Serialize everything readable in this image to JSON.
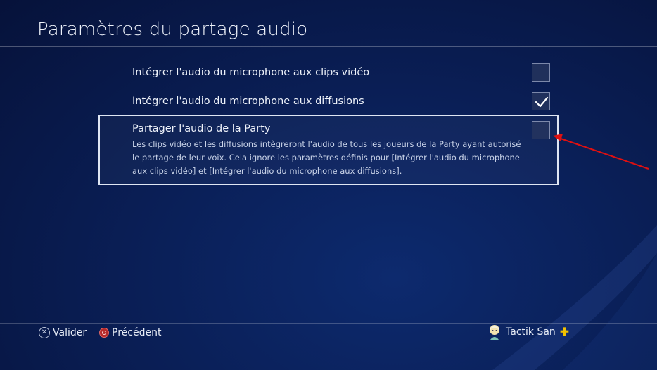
{
  "page": {
    "title": "Paramètres du partage audio"
  },
  "settings": [
    {
      "label": "Intégrer l'audio du microphone aux clips vidéo",
      "checked": false
    },
    {
      "label": "Intégrer l'audio du microphone aux diffusions",
      "checked": true
    },
    {
      "label": "Partager l'audio de la Party",
      "checked": false,
      "selected": true,
      "description": "Les clips vidéo et les diffusions intègreront l'audio de tous les joueurs de la Party ayant autorisé le partage de leur voix. Cela ignore les paramètres définis pour [Intégrer l'audio du microphone aux clips vidéo] et [Intégrer l'audio du microphone aux diffusions]."
    }
  ],
  "footer": {
    "confirm_label": "Valider",
    "back_label": "Précédent",
    "confirm_icon": "cross-button-icon",
    "back_icon": "circle-button-icon"
  },
  "user": {
    "name": "Tactik San",
    "plus_icon": "playstation-plus-icon"
  },
  "colors": {
    "accent_arrow": "#e01010",
    "ps_plus": "#f2c200",
    "background": "#0a1f57"
  }
}
